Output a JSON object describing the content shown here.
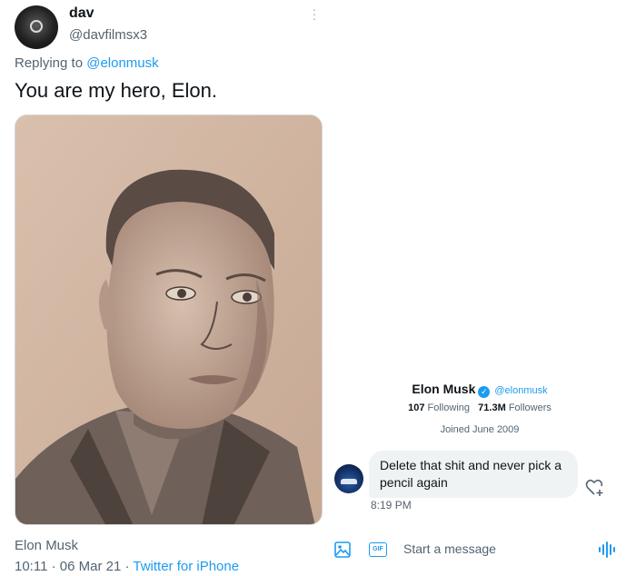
{
  "tweet": {
    "display_name": "dav",
    "handle": "@davfilmsx3",
    "replying_prefix": "Replying to",
    "replying_to": "@elonmusk",
    "text": "You are my hero, Elon.",
    "media": {
      "kind": "pencil-drawing",
      "subject": "Elon Musk"
    },
    "meta_name": "Elon Musk",
    "timestamp": "10:11 · 06 Mar 21 ·",
    "source": "Twitter for iPhone",
    "more_icon": "more-vertical-icon"
  },
  "dm": {
    "profile": {
      "name": "Elon Musk",
      "handle": "@elonmusk",
      "following_count": "107",
      "following_label": "Following",
      "followers_count": "71.3M",
      "followers_label": "Followers",
      "joined": "Joined June 2009",
      "verified_icon": "verified-badge-icon"
    },
    "message": {
      "text": "Delete that shit and never pick a pencil again",
      "time": "8:19 PM"
    },
    "composer": {
      "placeholder": "Start a message",
      "gif_label": "GIF",
      "icons": [
        "image-icon",
        "gif-icon",
        "voice-icon",
        "add-reaction-icon"
      ]
    }
  },
  "colors": {
    "link": "#1d9bf0",
    "secondary_text": "#536471",
    "bubble": "#eff3f4"
  }
}
